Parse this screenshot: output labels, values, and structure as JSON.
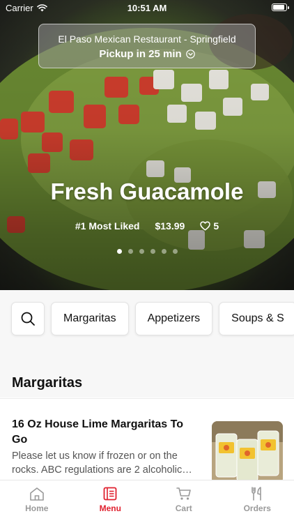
{
  "status_bar": {
    "carrier": "Carrier",
    "time": "10:51 AM"
  },
  "header": {
    "restaurant": "El Paso Mexican Restaurant - Springfield",
    "pickup": "Pickup in 25 min"
  },
  "hero": {
    "title": "Fresh Guacamole",
    "badge": "#1 Most Liked",
    "price": "$13.99",
    "likes": "5",
    "carousel": {
      "count": 6,
      "active_index": 0
    }
  },
  "categories": {
    "items": [
      "Margaritas",
      "Appetizers",
      "Soups & S"
    ]
  },
  "section": {
    "title": "Margaritas"
  },
  "menu_item": {
    "name": "16 Oz House Lime Margaritas To Go",
    "description": "Please let us know if frozen or on the rocks. ABC regulations are 2 alcoholic…"
  },
  "tabs": [
    {
      "label": "Home",
      "icon": "home-icon",
      "active": false
    },
    {
      "label": "Menu",
      "icon": "menu-icon",
      "active": true
    },
    {
      "label": "Cart",
      "icon": "cart-icon",
      "active": false
    },
    {
      "label": "Orders",
      "icon": "orders-icon",
      "active": false
    }
  ],
  "colors": {
    "accent": "#e0212f",
    "inactive": "#9a9a9a"
  }
}
